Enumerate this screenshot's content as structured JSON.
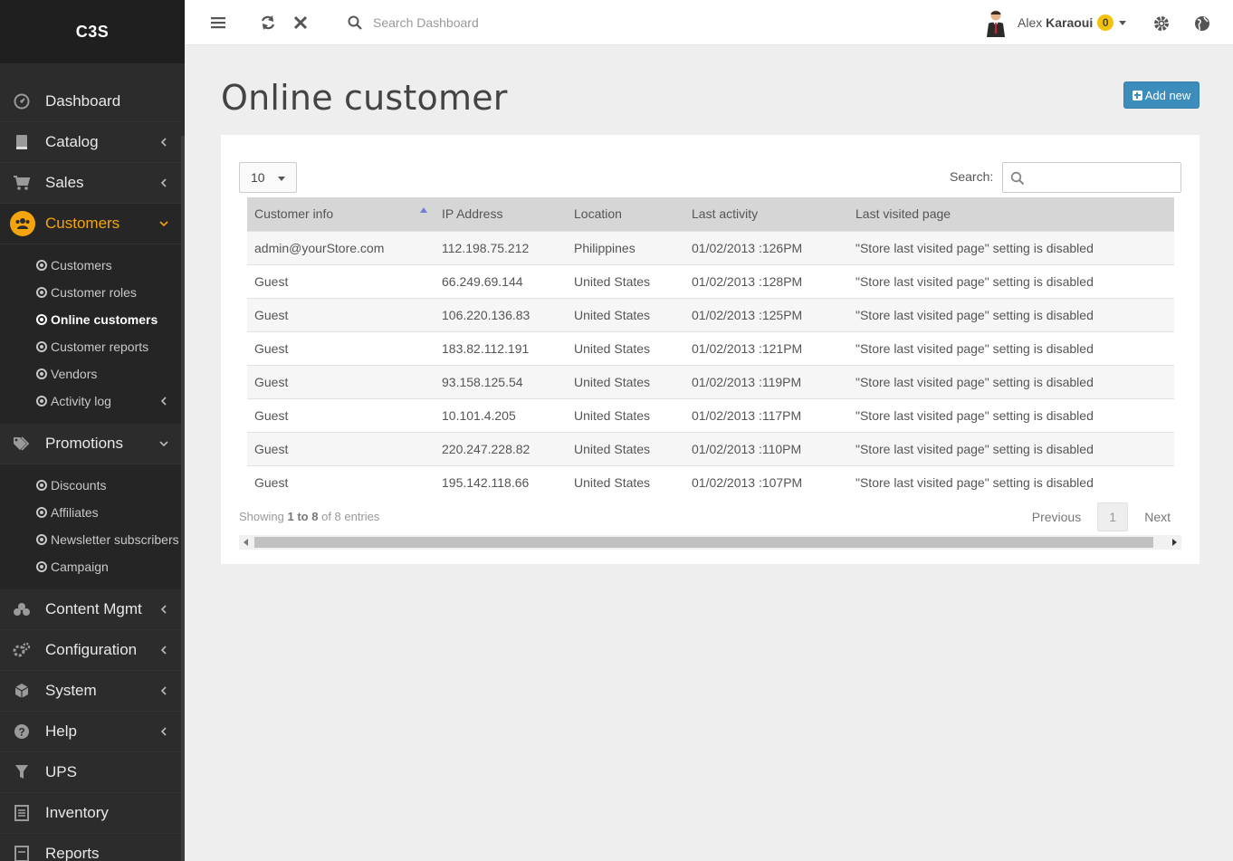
{
  "brand": "C3S",
  "header": {
    "search_placeholder": "Search Dashboard",
    "user_first": "Alex",
    "user_last": "Karaoui",
    "notification_count": "0"
  },
  "sidebar": {
    "items": [
      {
        "label": "Dashboard",
        "icon": "dashboard-icon"
      },
      {
        "label": "Catalog",
        "icon": "book-icon"
      },
      {
        "label": "Sales",
        "icon": "cart-icon"
      },
      {
        "label": "Customers",
        "icon": "users-icon"
      },
      {
        "label": "Promotions",
        "icon": "tags-icon"
      },
      {
        "label": "Content Mgmt",
        "icon": "cubes-icon"
      },
      {
        "label": "Configuration",
        "icon": "cogs-icon"
      },
      {
        "label": "System",
        "icon": "cube-icon"
      },
      {
        "label": "Help",
        "icon": "question-icon"
      },
      {
        "label": "UPS",
        "icon": "filter-icon"
      },
      {
        "label": "Inventory",
        "icon": "list-icon"
      },
      {
        "label": "Reports",
        "icon": "report-icon"
      }
    ],
    "customers_sub": [
      "Customers",
      "Customer roles",
      "Online customers",
      "Customer reports",
      "Vendors",
      "Activity log"
    ],
    "promotions_sub": [
      "Discounts",
      "Affiliates",
      "Newsletter subscribers",
      "Campaign"
    ]
  },
  "page": {
    "title": "Online customer",
    "add_label": "Add new"
  },
  "table": {
    "page_length": "10",
    "search_label": "Search:",
    "columns": [
      "Customer info",
      "IP Address",
      "Location",
      "Last activity",
      "Last visited page"
    ],
    "rows": [
      [
        "admin@yourStore.com",
        "112.198.75.212",
        "Philippines",
        "01/02/2013 :126PM",
        "\"Store last visited page\" setting is disabled"
      ],
      [
        "Guest",
        "66.249.69.144",
        "United States",
        "01/02/2013 :128PM",
        "\"Store last visited page\" setting is disabled"
      ],
      [
        "Guest",
        "106.220.136.83",
        "United States",
        "01/02/2013 :125PM",
        "\"Store last visited page\" setting is disabled"
      ],
      [
        "Guest",
        "183.82.112.191",
        "United States",
        "01/02/2013 :121PM",
        "\"Store last visited page\" setting is disabled"
      ],
      [
        "Guest",
        "93.158.125.54",
        "United States",
        "01/02/2013 :119PM",
        "\"Store last visited page\" setting is disabled"
      ],
      [
        "Guest",
        "10.101.4.205",
        "United States",
        "01/02/2013 :117PM",
        "\"Store last visited page\" setting is disabled"
      ],
      [
        "Guest",
        "220.247.228.82",
        "United States",
        "01/02/2013 :110PM",
        "\"Store last visited page\" setting is disabled"
      ],
      [
        "Guest",
        "195.142.118.66",
        "United States",
        "01/02/2013 :107PM",
        "\"Store last visited page\" setting is disabled"
      ]
    ],
    "info_prefix": "Showing",
    "info_range": "1 to 8",
    "info_suffix": "of 8 entries",
    "prev_label": "Previous",
    "page_number": "1",
    "next_label": "Next"
  },
  "colors": {
    "accent": "#f4a40c",
    "primary_button": "#3c8dbc",
    "sidebar_bg": "#2c2c2c"
  }
}
